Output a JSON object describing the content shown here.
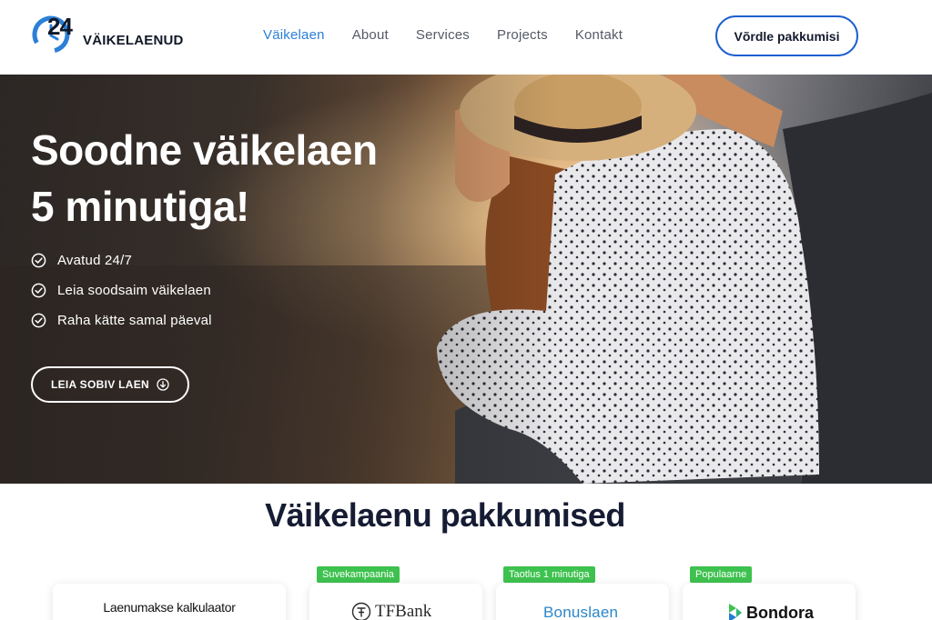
{
  "header": {
    "logo_number": "24",
    "logo_text": "VÄIKELAENUD",
    "nav": [
      {
        "label": "Väikelaen",
        "active": true
      },
      {
        "label": "About",
        "active": false
      },
      {
        "label": "Services",
        "active": false
      },
      {
        "label": "Projects",
        "active": false
      },
      {
        "label": "Kontakt",
        "active": false
      }
    ],
    "cta_label": "Võrdle pakkumisi"
  },
  "hero": {
    "title_line1": "Soodne väikelaen",
    "title_line2": "5 minutiga!",
    "features": [
      "Avatud 24/7",
      "Leia soodsaim väikelaen",
      "Raha kätte samal päeval"
    ],
    "button_label": "LEIA SOBIV LAEN"
  },
  "offers": {
    "section_title": "Väikelaenu pakkumised",
    "calculator_title": "Laenumakse kalkulaator",
    "cards": [
      {
        "badge": "Suvekampaania",
        "brand": "TFBank"
      },
      {
        "badge": "Taotlus 1 minutiga",
        "brand": "Bonuslaen"
      },
      {
        "badge": "Populaarne",
        "brand": "Bondora"
      }
    ]
  },
  "colors": {
    "accent_blue": "#2b7fd8",
    "button_border": "#1d5fcf",
    "badge_green": "#3ec24f",
    "heading_dark": "#161c33"
  }
}
